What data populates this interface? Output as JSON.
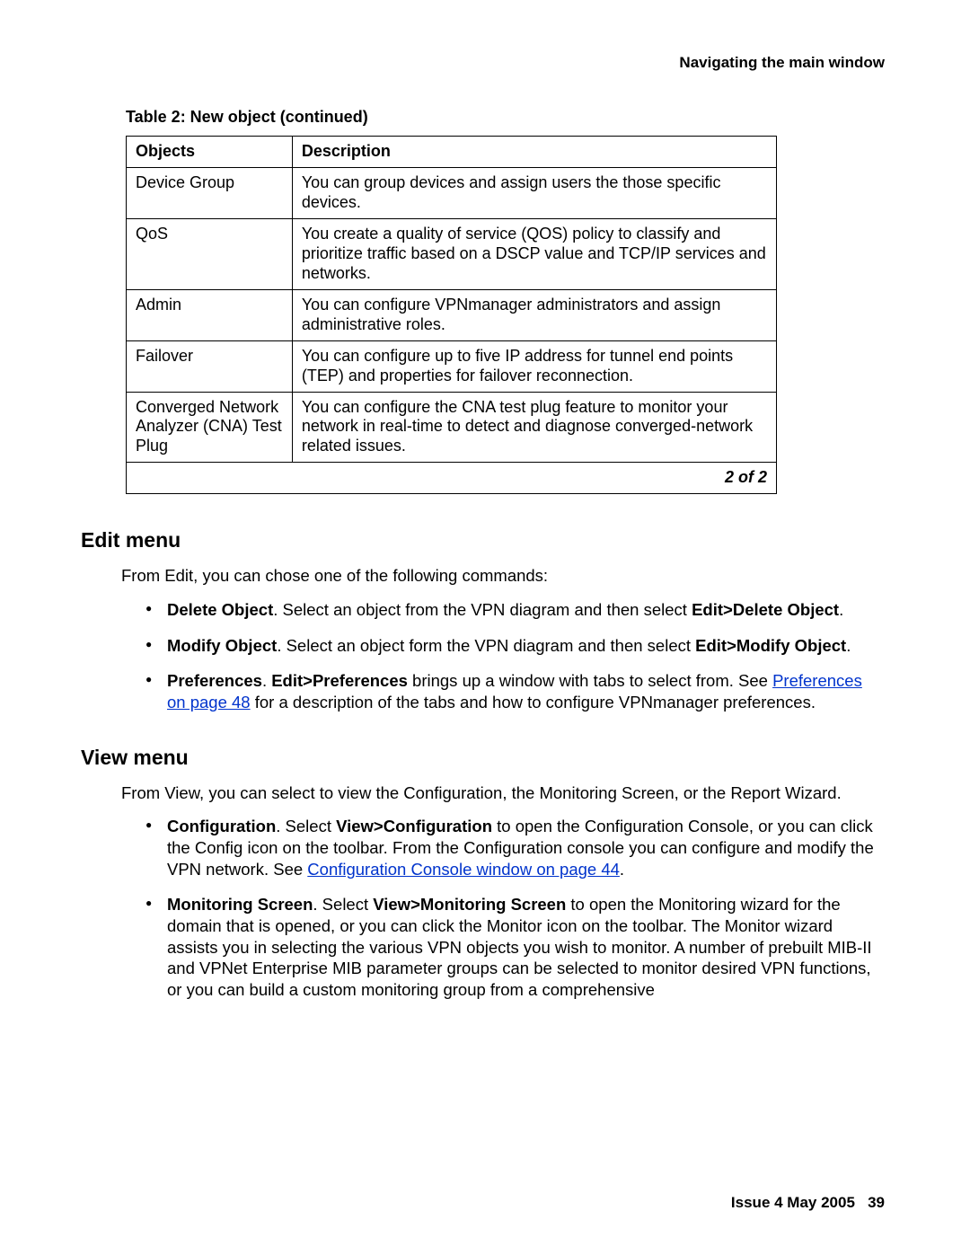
{
  "running_head": "Navigating the main window",
  "table": {
    "caption": "Table 2: New object  (continued)",
    "head": {
      "col1": "Objects",
      "col2": "Description"
    },
    "rows": [
      {
        "obj": "Device Group",
        "desc": "You can group devices and assign users the those specific devices."
      },
      {
        "obj": "QoS",
        "desc": "You create a quality of service (QOS) policy to classify and prioritize traffic based on a DSCP value and TCP/IP services and networks."
      },
      {
        "obj": "Admin",
        "desc": "You can configure VPNmanager administrators and assign administrative roles."
      },
      {
        "obj": "Failover",
        "desc": "You can configure up to five IP address for tunnel end points (TEP) and properties for failover reconnection."
      },
      {
        "obj": "Converged Network Analyzer (CNA) Test Plug",
        "desc": "You can configure the CNA test plug feature to monitor your network in real-time to detect and diagnose converged-network related issues."
      }
    ],
    "paging": "2 of 2"
  },
  "edit": {
    "heading": "Edit menu",
    "intro": "From Edit, you can chose one of the following commands:",
    "items": {
      "delete": {
        "bold1": "Delete Object",
        "mid": ". Select an object from the VPN diagram and then select ",
        "bold2": "Edit>Delete Object",
        "tail": "."
      },
      "modify": {
        "bold1": "Modify Object",
        "mid": ". Select an object form the VPN diagram and then select ",
        "bold2": "Edit>Modify Object",
        "tail": "."
      },
      "prefs": {
        "bold1": "Preferences",
        "sep": ". ",
        "bold2": "Edit>Preferences",
        "mid": " brings up a window with tabs to select from. See ",
        "link": "Preferences on page 48",
        "tail": " for a description of the tabs and how to configure VPNmanager preferences."
      }
    }
  },
  "view": {
    "heading": "View menu",
    "intro": "From View, you can select to view the Configuration, the Monitoring Screen, or the Report Wizard.",
    "items": {
      "config": {
        "bold1": "Configuration",
        "sep": ". Select ",
        "bold2": "View>Configuration",
        "mid": " to open the Configuration Console, or you can click the Config icon on the toolbar. From the Configuration console you can configure and modify the VPN network. See ",
        "link": "Configuration Console window on page 44",
        "tail": "."
      },
      "monitor": {
        "bold1": "Monitoring Screen",
        "sep": ". Select ",
        "bold2": "View>Monitoring Screen",
        "tail": " to open the Monitoring wizard for the domain that is opened, or you can click the Monitor icon on the toolbar. The Monitor wizard assists you in selecting the various VPN objects you wish to monitor. A number of prebuilt MIB-II and VPNet Enterprise MIB parameter groups can be selected to monitor desired VPN functions, or you can build a custom monitoring group from a comprehensive"
      }
    }
  },
  "footer": {
    "issue": "Issue 4   May 2005",
    "page": "39"
  }
}
